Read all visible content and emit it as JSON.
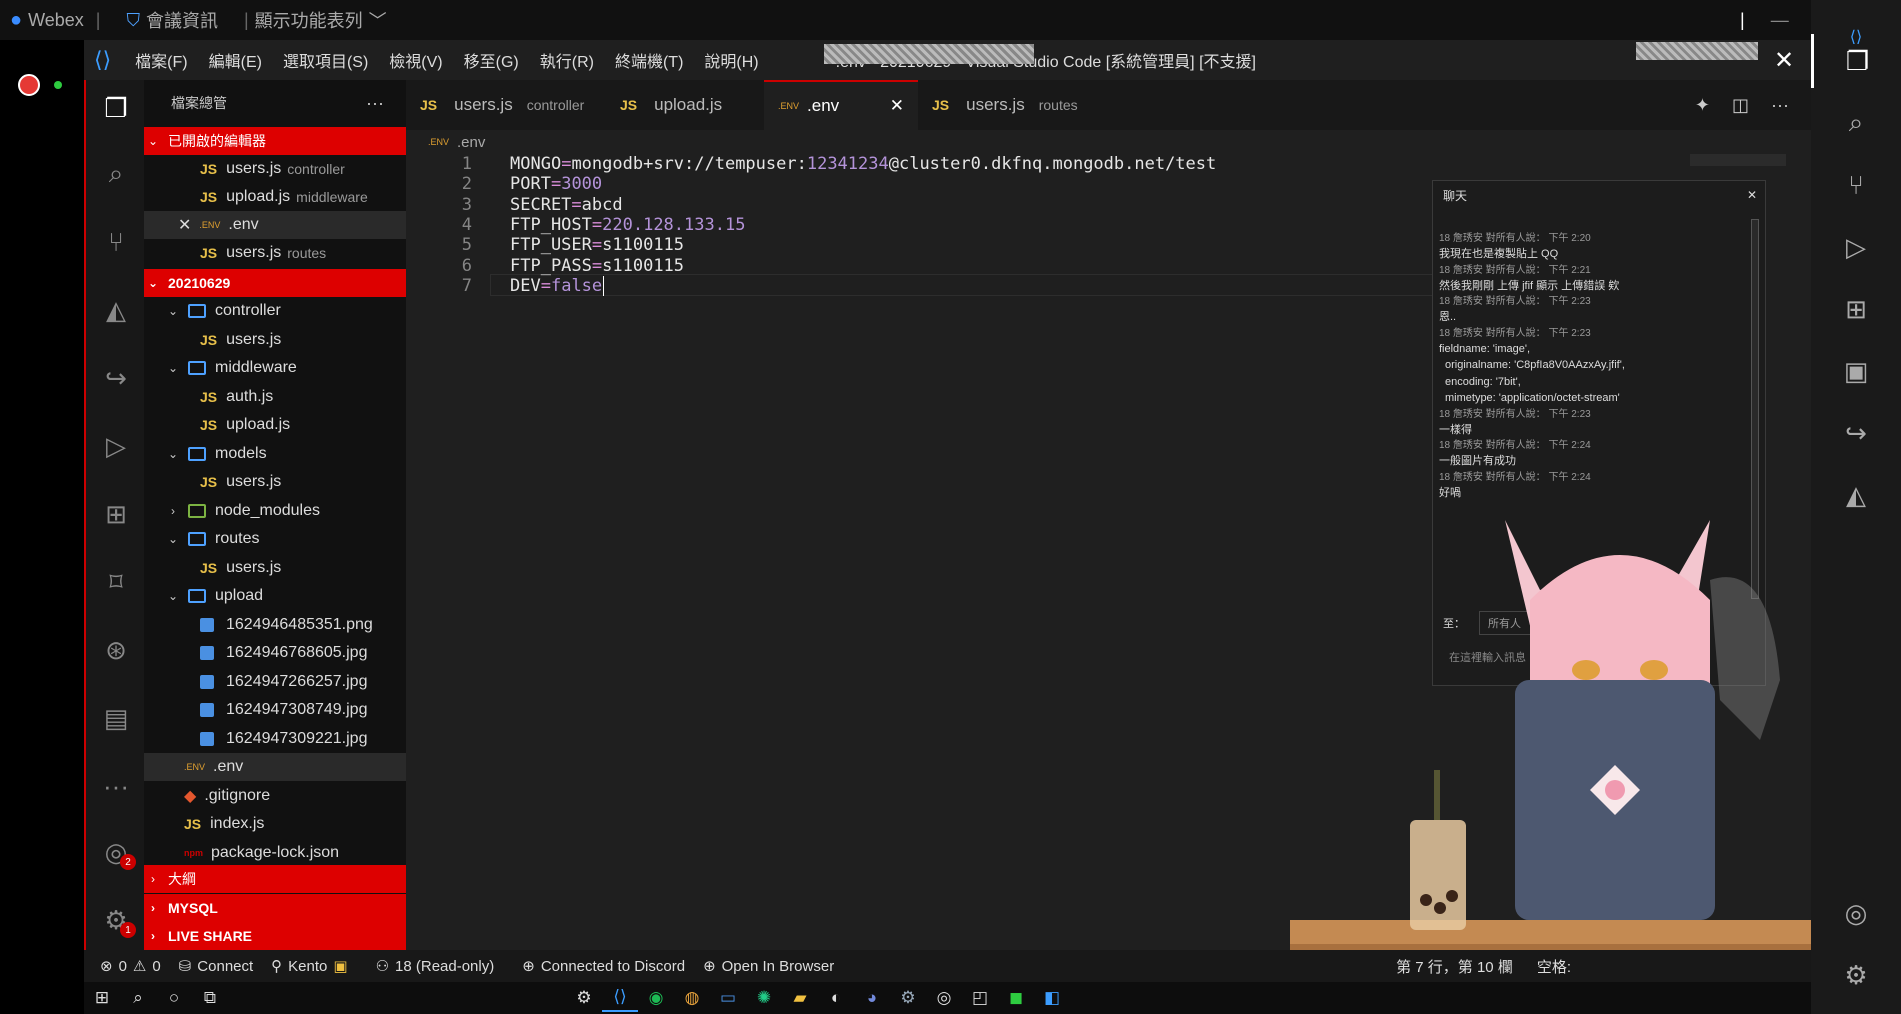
{
  "webex": {
    "app_name": "Webex",
    "meeting_info": "會議資訊",
    "view_menu": "顯示功能表列"
  },
  "vscode": {
    "window_title": ".env - 20210629 - Visual Studio Code [系統管理員] [不支援]",
    "menu": [
      "檔案(F)",
      "編輯(E)",
      "選取項目(S)",
      "檢視(V)",
      "移至(G)",
      "執行(R)",
      "終端機(T)",
      "說明(H)"
    ],
    "sidebar": {
      "title": "檔案總管",
      "open_editors_header": "已開啟的編輯器",
      "open_editors": [
        {
          "name": "users.js",
          "dir": "controller",
          "type": "JS"
        },
        {
          "name": "upload.js",
          "dir": "middleware",
          "type": "JS"
        },
        {
          "name": ".env",
          "dir": "",
          "type": ".ENV"
        },
        {
          "name": "users.js",
          "dir": "routes",
          "type": "JS"
        }
      ],
      "project_header": "20210629",
      "tree": [
        {
          "label": "controller",
          "kind": "folder"
        },
        {
          "label": "users.js",
          "kind": "js"
        },
        {
          "label": "middleware",
          "kind": "folder"
        },
        {
          "label": "auth.js",
          "kind": "js"
        },
        {
          "label": "upload.js",
          "kind": "js"
        },
        {
          "label": "models",
          "kind": "folder"
        },
        {
          "label": "users.js",
          "kind": "js"
        },
        {
          "label": "node_modules",
          "kind": "folder-closed"
        },
        {
          "label": "routes",
          "kind": "folder"
        },
        {
          "label": "users.js",
          "kind": "js"
        },
        {
          "label": "upload",
          "kind": "folder"
        },
        {
          "label": "1624946485351.png",
          "kind": "img"
        },
        {
          "label": "1624946768605.jpg",
          "kind": "img"
        },
        {
          "label": "1624947266257.jpg",
          "kind": "img"
        },
        {
          "label": "1624947308749.jpg",
          "kind": "img"
        },
        {
          "label": "1624947309221.jpg",
          "kind": "img"
        },
        {
          "label": ".env",
          "kind": "env"
        },
        {
          "label": ".gitignore",
          "kind": "git"
        },
        {
          "label": "index.js",
          "kind": "js"
        },
        {
          "label": "package-lock.json",
          "kind": "npm"
        }
      ],
      "outline_header": "大綱",
      "mysql_header": "MYSQL",
      "liveshare_header": "LIVE SHARE"
    },
    "tabs": [
      {
        "type": "JS",
        "name": "users.js",
        "dir": "controller"
      },
      {
        "type": "JS",
        "name": "upload.js",
        "dir": ""
      },
      {
        "type": ".ENV",
        "name": ".env",
        "dir": ""
      },
      {
        "type": "JS",
        "name": "users.js",
        "dir": "routes"
      }
    ],
    "breadcrumb": {
      "type": ".ENV",
      "name": ".env"
    },
    "code_lines": [
      {
        "n": "1",
        "key": "MONGO",
        "val_a": "mongodb+srv://tempuser:",
        "val_b": "12341234",
        "val_c": "@cluster0.dkfnq.mongodb.net/test"
      },
      {
        "n": "2",
        "key": "PORT",
        "val_a": "",
        "val_b": "3000",
        "val_c": ""
      },
      {
        "n": "3",
        "key": "SECRET",
        "val_a": "abcd",
        "val_b": "",
        "val_c": ""
      },
      {
        "n": "4",
        "key": "FTP_HOST",
        "val_a": "",
        "val_b": "220.128.133.15",
        "val_c": ""
      },
      {
        "n": "5",
        "key": "FTP_USER",
        "val_a": "s1100115",
        "val_b": "",
        "val_c": ""
      },
      {
        "n": "6",
        "key": "FTP_PASS",
        "val_a": "s1100115",
        "val_b": "",
        "val_c": ""
      },
      {
        "n": "7",
        "key": "DEV",
        "val_a": "",
        "val_b": "false",
        "val_c": ""
      }
    ],
    "status": {
      "errors": "0",
      "warnings": "0",
      "connect": "Connect",
      "user": "Kento",
      "readonly": "18 (Read-only)",
      "discord": "Connected to Discord",
      "browser": "Open In Browser",
      "position": "第 7 行，第 10 欄",
      "spaces": "空格:"
    },
    "badges": {
      "accounts": "2",
      "settings": "1"
    }
  },
  "chat": {
    "title": "聊天",
    "messages": [
      {
        "meta": "18 詹琇安 對所有人說：  下午 2:20",
        "text": "我現在也是複製貼上 QQ"
      },
      {
        "meta": "18 詹琇安 對所有人說：  下午 2:21",
        "text": "然後我剛剛 上傳 jfif 顯示 上傳錯誤 欸"
      },
      {
        "meta": "18 詹琇安 對所有人說：  下午 2:23",
        "text": "恩.."
      },
      {
        "meta": "18 詹琇安 對所有人說：  下午 2:23",
        "text": "fieldname: 'image',"
      },
      {
        "meta": "",
        "text": "originalname: 'C8pfIa8V0AAzxAy.jfif',"
      },
      {
        "meta": "",
        "text": "encoding: '7bit',"
      },
      {
        "meta": "",
        "text": "mimetype: 'application/octet-stream'"
      },
      {
        "meta": "18 詹琇安 對所有人說：  下午 2:23",
        "text": "一樣得"
      },
      {
        "meta": "18 詹琇安 對所有人說：  下午 2:24",
        "text": "一般圖片有成功"
      },
      {
        "meta": "18 詹琇安 對所有人說：  下午 2:24",
        "text": "好喎"
      }
    ],
    "to_label": "至：",
    "to_value": "所有人",
    "input_placeholder": "在這裡輸入訊息"
  },
  "colors": {
    "accent": "#cc0000",
    "js": "#e8c04a",
    "folder": "#4ea1ff",
    "number": "#b493d9",
    "operator": "#d98cd9"
  }
}
